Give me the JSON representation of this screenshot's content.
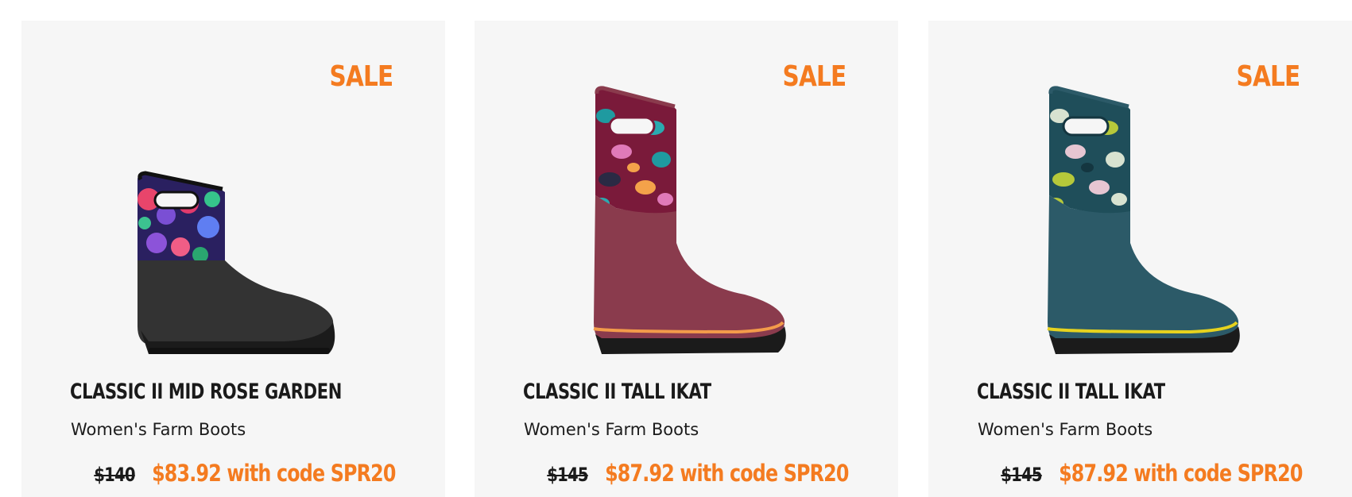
{
  "products": [
    {
      "badge": "SALE",
      "name": "CLASSIC II MID ROSE GARDEN",
      "category": "Women's Farm Boots",
      "original_price": "$140",
      "sale_price": "$83.92 with code SPR20",
      "image": "mid-boot-rose-garden"
    },
    {
      "badge": "SALE",
      "name": "CLASSIC II TALL IKAT",
      "category": "Women's Farm Boots",
      "original_price": "$145",
      "sale_price": "$87.92 with code SPR20",
      "image": "tall-boot-ikat-burgundy"
    },
    {
      "badge": "SALE",
      "name": "CLASSIC II TALL IKAT",
      "category": "Women's Farm Boots",
      "original_price": "$145",
      "sale_price": "$87.92 with code SPR20",
      "image": "tall-boot-ikat-teal"
    }
  ],
  "colors": {
    "accent_orange": "#f47b20",
    "card_background": "#f6f6f6",
    "text_dark": "#1a1a1a"
  }
}
